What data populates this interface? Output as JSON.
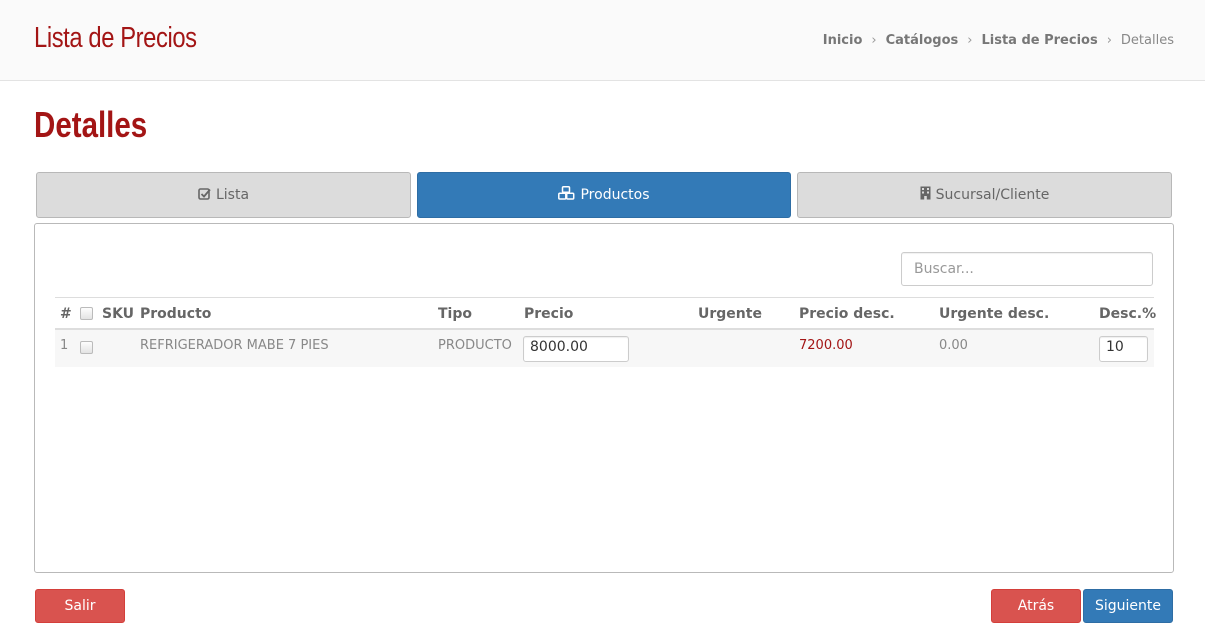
{
  "header": {
    "app_title": "Lista de Precios",
    "breadcrumb": [
      "Inicio",
      "Catálogos",
      "Lista de Precios",
      "Detalles"
    ]
  },
  "page": {
    "section_title": "Detalles"
  },
  "tabs": [
    {
      "label": "Lista",
      "icon": "check-square-icon",
      "active": false
    },
    {
      "label": "Productos",
      "icon": "cubes-icon",
      "active": true
    },
    {
      "label": "Sucursal/Cliente",
      "icon": "building-icon",
      "active": false
    }
  ],
  "search": {
    "placeholder": "Buscar...",
    "value": ""
  },
  "table": {
    "columns": [
      "#",
      "SKU",
      "Producto",
      "Tipo",
      "Precio",
      "Urgente",
      "Precio desc.",
      "Urgente desc.",
      "Desc.%"
    ],
    "rows": [
      {
        "num": "1",
        "sku": "",
        "producto": "REFRIGERADOR MABE 7 PIES",
        "tipo": "PRODUCTO",
        "precio": "8000.00",
        "urgente": "",
        "precio_desc": "7200.00",
        "urgente_desc": "0.00",
        "desc_pct": "10"
      }
    ]
  },
  "buttons": {
    "exit": "Salir",
    "back": "Atrás",
    "next": "Siguiente"
  },
  "colors": {
    "brand_red": "#a31515",
    "primary": "#337ab7",
    "danger": "#d9534f"
  }
}
